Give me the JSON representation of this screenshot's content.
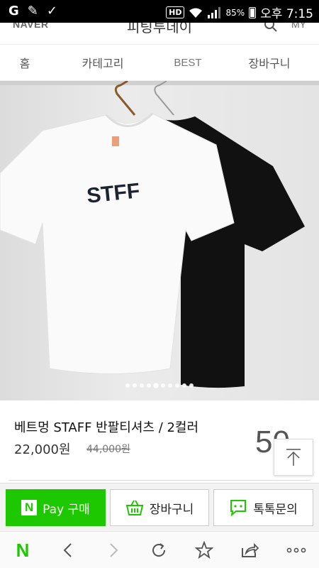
{
  "status_bar": {
    "left_icons": [
      "G",
      "✎",
      "✓"
    ],
    "hd": "HD",
    "battery": "85%",
    "time": "오후 7:15"
  },
  "header": {
    "logo": "NAVER",
    "store_name": "피팅투데이",
    "my": "MY",
    "icons": [
      "search-icon"
    ]
  },
  "nav": {
    "items": [
      "홈",
      "카테고리",
      "BEST",
      "장바구니"
    ]
  },
  "gallery": {
    "print_text": "STFF",
    "image_count": 10,
    "current_index": 4
  },
  "product": {
    "name": "베트멍 STAFF 반팔티셔츠 / 2컬러",
    "price": "22,000원",
    "original_price": "44,000원",
    "discount": "50"
  },
  "actions": {
    "pay_badge": "N",
    "pay_label": "Pay 구매",
    "cart_label": "장바구니",
    "talk_label": "톡톡문의",
    "icons": [
      "basket-icon",
      "chat-icon",
      "scroll-top-icon"
    ]
  },
  "browser": {
    "logo": "N",
    "icons": [
      "back-icon",
      "forward-icon",
      "refresh-icon",
      "bookmark-icon",
      "share-icon",
      "more-icon"
    ]
  },
  "colors": {
    "naver_green": "#1ec800",
    "status_bar": "#000000"
  }
}
